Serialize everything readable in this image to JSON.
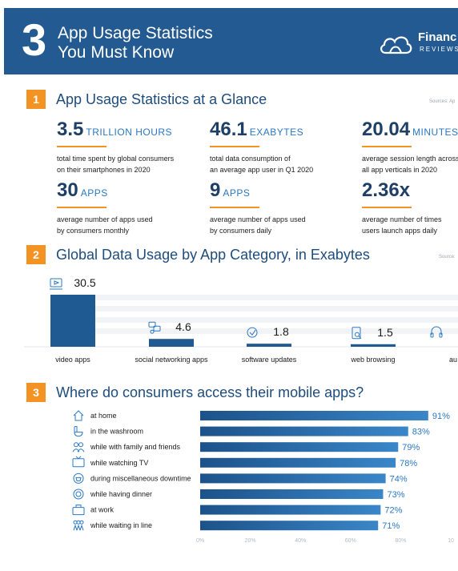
{
  "header": {
    "number": "3",
    "title_line1": "App Usage Statistics",
    "title_line2": "You Must Know",
    "logo_text": "Financ",
    "logo_sub": "REVIEWS"
  },
  "section1": {
    "number": "1",
    "title": "App Usage Statistics at a Glance",
    "source": "Sources: Ap",
    "stats": [
      {
        "value": "3.5",
        "unit": "TRILLION HOURS",
        "desc1": "total time spent by global consumers",
        "desc2": "on their smartphones in 2020"
      },
      {
        "value": "46.1",
        "unit": "EXABYTES",
        "desc1": "total data consumption of",
        "desc2": "an average app user in Q1 2020"
      },
      {
        "value": "20.04",
        "unit": "MINUTES",
        "desc1": "average session length across",
        "desc2": "all app verticals in 2020"
      },
      {
        "value": "30",
        "unit": "APPS",
        "desc1": "average number of apps used",
        "desc2": "by consumers monthly"
      },
      {
        "value": "9",
        "unit": "APPS",
        "desc1": "average number of apps used",
        "desc2": "by consumers daily"
      },
      {
        "value": "2.36x",
        "unit": "",
        "desc1": "average number of times",
        "desc2": "users launch apps daily"
      }
    ]
  },
  "section2": {
    "number": "2",
    "title": "Global Data Usage by App Category, in Exabytes",
    "source": "Source:"
  },
  "section3": {
    "number": "3",
    "title": "Where do consumers access their mobile apps?"
  },
  "chart_data": [
    {
      "type": "bar",
      "title": "Global Data Usage by App Category, in Exabytes",
      "categories": [
        "video apps",
        "social networking apps",
        "software updates",
        "web browsing",
        "au"
      ],
      "values": [
        30.5,
        4.6,
        1.8,
        1.5,
        null
      ],
      "value_labels": [
        "30.5",
        "4.6",
        "1.8",
        "1.5",
        ""
      ],
      "icons": [
        "video-icon",
        "social-networking-icon",
        "software-update-icon",
        "web-browsing-icon",
        "audio-headphones-icon"
      ],
      "bar_color": "#1f5a93"
    },
    {
      "type": "bar",
      "orientation": "horizontal",
      "title": "Where do consumers access their mobile apps?",
      "categories": [
        "at home",
        "in the washroom",
        "while with family and friends",
        "while watching TV",
        "during miscellaneous downtime",
        "while having dinner",
        "at work",
        "while waiting in line"
      ],
      "values": [
        91,
        83,
        79,
        78,
        74,
        73,
        72,
        71
      ],
      "value_labels": [
        "91%",
        "83%",
        "79%",
        "78%",
        "74%",
        "73%",
        "72%",
        "71%"
      ],
      "icons": [
        "home-icon",
        "toilet-icon",
        "people-icon",
        "tv-icon",
        "coffee-icon",
        "dinner-plate-icon",
        "briefcase-icon",
        "waiting-line-icon"
      ],
      "xlim": [
        0,
        100
      ],
      "xticks": [
        "0%",
        "20%",
        "40%",
        "60%",
        "80%",
        "10"
      ],
      "bar_color_start": "#1c5289",
      "bar_color_end": "#3a86c8"
    }
  ]
}
